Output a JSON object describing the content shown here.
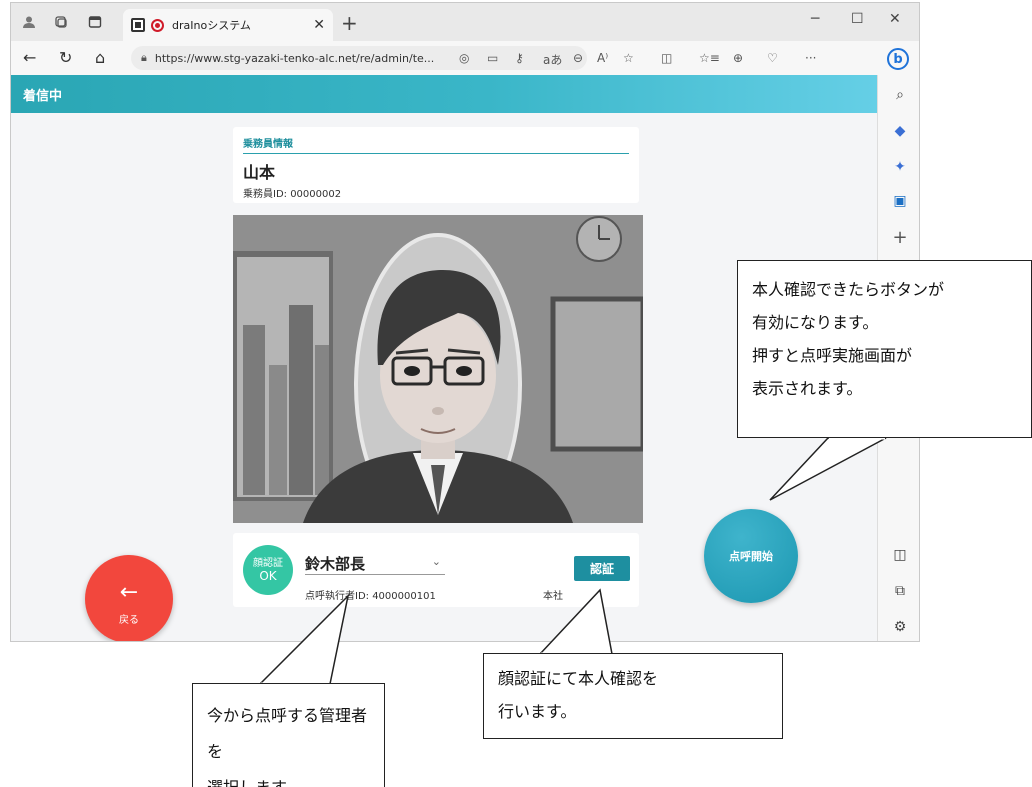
{
  "browser": {
    "tab_title": "draInoシステム",
    "url": "https://www.stg-yazaki-tenko-alc.net/re/admin/te..."
  },
  "page": {
    "header_title": "着信中",
    "crew": {
      "section_label": "乗務員情報",
      "name": "山本",
      "id_text": "乗務員ID: 00000002"
    },
    "face_auth": {
      "line1": "顔認証",
      "line2": "OK"
    },
    "manager": {
      "selected": "鈴木部長",
      "id_text": "点呼執行者ID: 4000000101",
      "office": "本社"
    },
    "auth_button": "認証",
    "back_button": {
      "icon": "arrow-left-icon",
      "label": "戻る"
    },
    "start_button": "点呼開始"
  },
  "callouts": {
    "right": [
      "本人確認できたらボタンが",
      "有効になります。",
      "押すと点呼実施画面が",
      "表示されます。"
    ],
    "middle": [
      "顔認証にて本人確認を",
      "行います。"
    ],
    "left": [
      "今から点呼する管理者を",
      "選択します。"
    ]
  },
  "colors": {
    "header_gradient_start": "#2aa6b4",
    "header_gradient_end": "#65cfe6",
    "back_button": "#f2473d",
    "start_button": "#1c97b1",
    "face_badge": "#34c6a4",
    "auth_button": "#1e8fa0"
  }
}
